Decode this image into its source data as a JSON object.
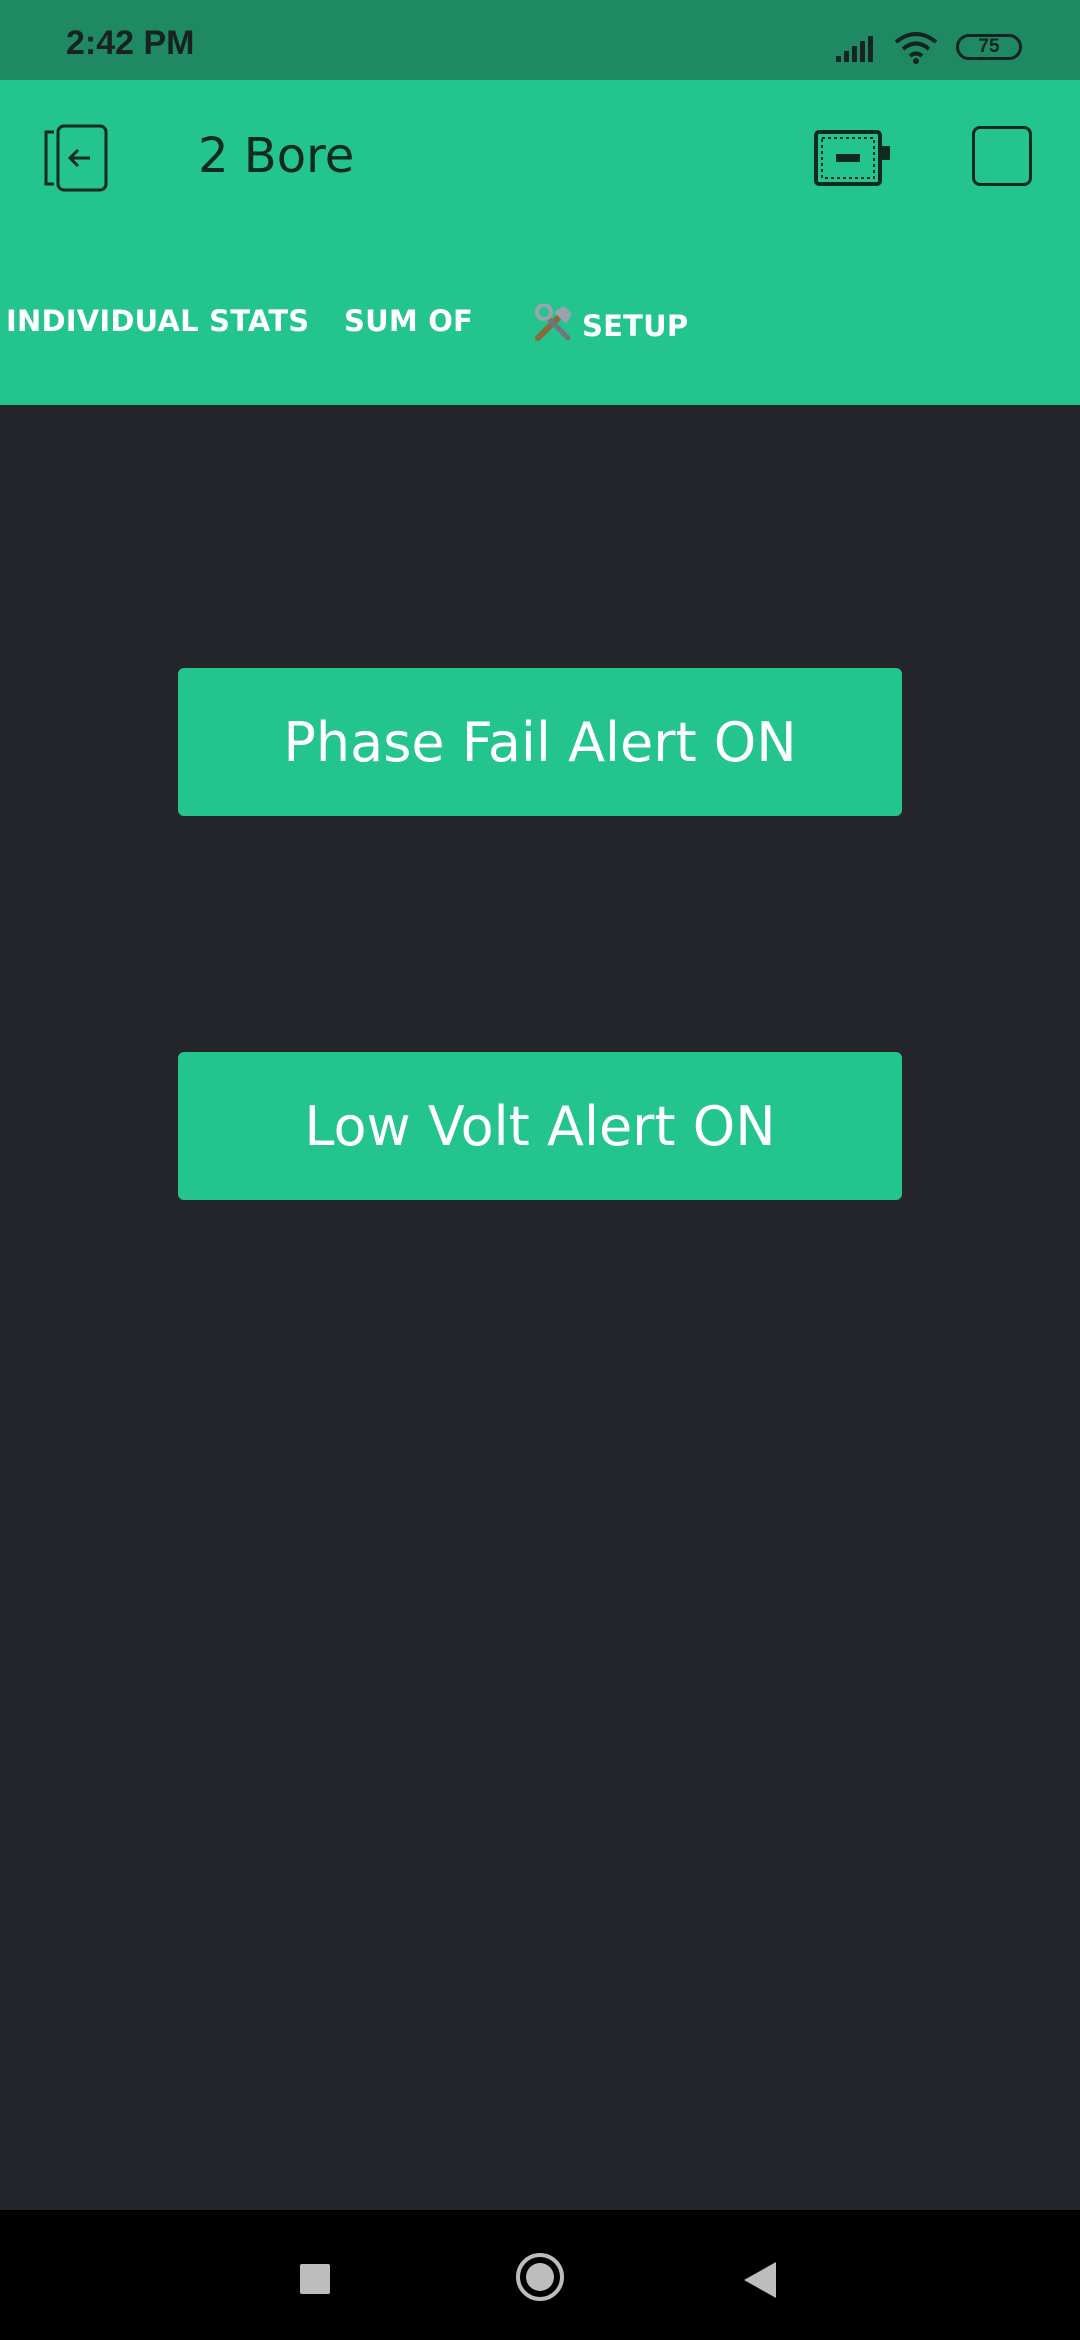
{
  "status_bar": {
    "time": "2:42 PM",
    "battery": "75",
    "icons": [
      "signal-icon",
      "wifi-icon",
      "battery-icon"
    ]
  },
  "app_bar": {
    "title": "2 Bore",
    "back_icon": "exit-icon",
    "device_icon": "device-board-icon",
    "stop_icon": "stop-square-icon"
  },
  "tabs": [
    {
      "label": "INDIVIDUAL STATS",
      "active": false
    },
    {
      "label": "SUM OF",
      "active": false
    },
    {
      "label": "SETUP",
      "icon": "tools-icon",
      "active": true
    }
  ],
  "main": {
    "buttons": [
      {
        "label": "Phase Fail Alert ON"
      },
      {
        "label": "Low Volt Alert ON"
      }
    ]
  },
  "nav_bar": {
    "icons": [
      "recents-icon",
      "home-icon",
      "back-icon"
    ]
  },
  "colors": {
    "status_bar": "#1e8962",
    "accent": "#23c48e",
    "background": "#23252b",
    "nav_bar": "#000000"
  }
}
